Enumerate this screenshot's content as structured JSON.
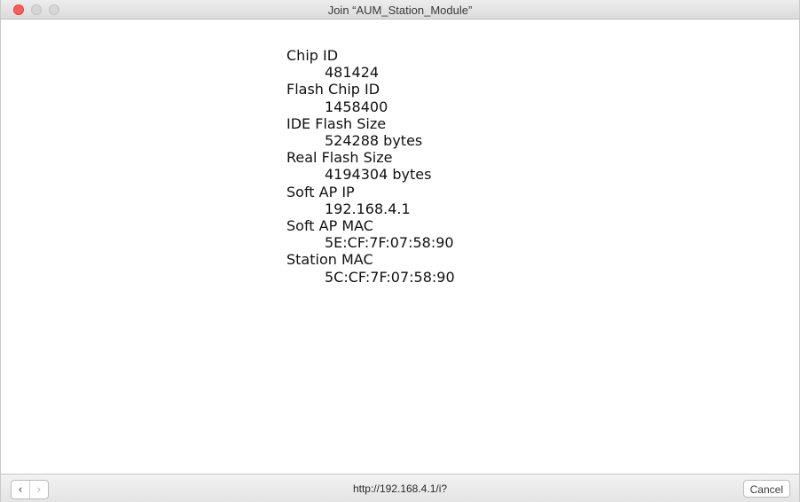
{
  "window": {
    "title": "Join “AUM_Station_Module”"
  },
  "info": {
    "items": [
      {
        "label": "Chip ID",
        "value": "481424"
      },
      {
        "label": "Flash Chip ID",
        "value": "1458400"
      },
      {
        "label": "IDE Flash Size",
        "value": "524288 bytes"
      },
      {
        "label": "Real Flash Size",
        "value": "4194304 bytes"
      },
      {
        "label": "Soft AP IP",
        "value": "192.168.4.1"
      },
      {
        "label": "Soft AP MAC",
        "value": "5E:CF:7F:07:58:90"
      },
      {
        "label": "Station MAC",
        "value": "5C:CF:7F:07:58:90"
      }
    ]
  },
  "bottombar": {
    "back_glyph": "‹",
    "forward_glyph": "›",
    "url": "http://192.168.4.1/i?",
    "cancel_label": "Cancel"
  },
  "icons": {
    "back": "chevron-left-icon",
    "forward": "chevron-right-icon"
  },
  "colors": {
    "close_button": "#fc5f57",
    "inactive_button": "#d6d6d6"
  }
}
